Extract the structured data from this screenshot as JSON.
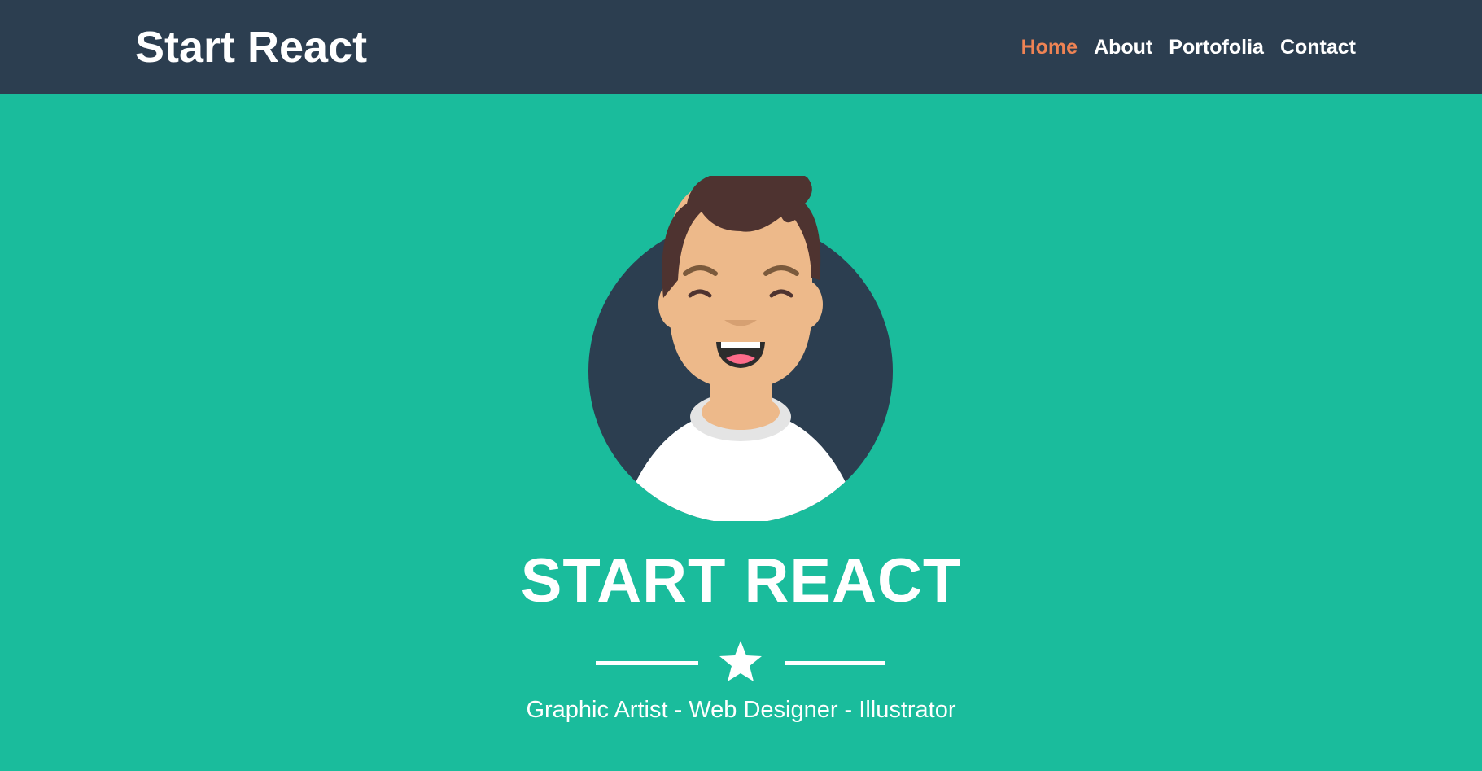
{
  "header": {
    "brand": "Start React",
    "nav": [
      {
        "label": "Home",
        "active": true
      },
      {
        "label": "About",
        "active": false
      },
      {
        "label": "Portofolia",
        "active": false
      },
      {
        "label": "Contact",
        "active": false
      }
    ]
  },
  "hero": {
    "avatar_icon": "smiling-man-avatar-icon",
    "title": "START REACT",
    "divider_icon": "star-icon",
    "subtitle": "Graphic Artist - Web Designer - Illustrator"
  },
  "colors": {
    "navbar_bg": "#2c3e50",
    "hero_bg": "#1abc9c",
    "active_link": "#ef8354",
    "text": "#ffffff"
  }
}
